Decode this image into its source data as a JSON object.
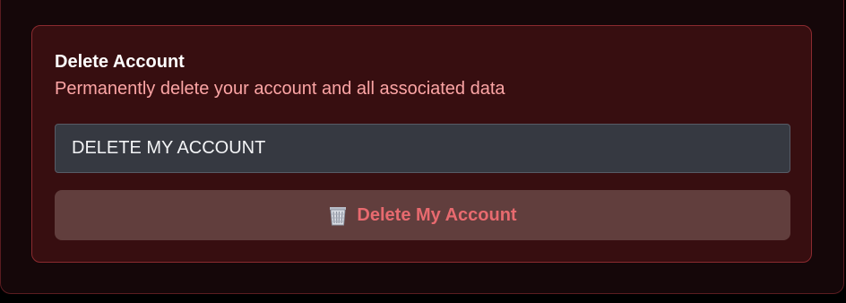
{
  "danger_zone": {
    "title": "Delete Account",
    "description": "Permanently delete your account and all associated data",
    "confirm_input": {
      "value": "DELETE MY ACCOUNT",
      "placeholder": ""
    },
    "delete_button": {
      "label": "Delete My Account",
      "icon": "trash-icon"
    }
  },
  "colors": {
    "card_background": "#370e10",
    "card_border": "#8b2a2f",
    "description_text": "#fca5a5",
    "button_background": "#613e3d",
    "button_text": "#e86a6f",
    "input_background": "#363941"
  }
}
